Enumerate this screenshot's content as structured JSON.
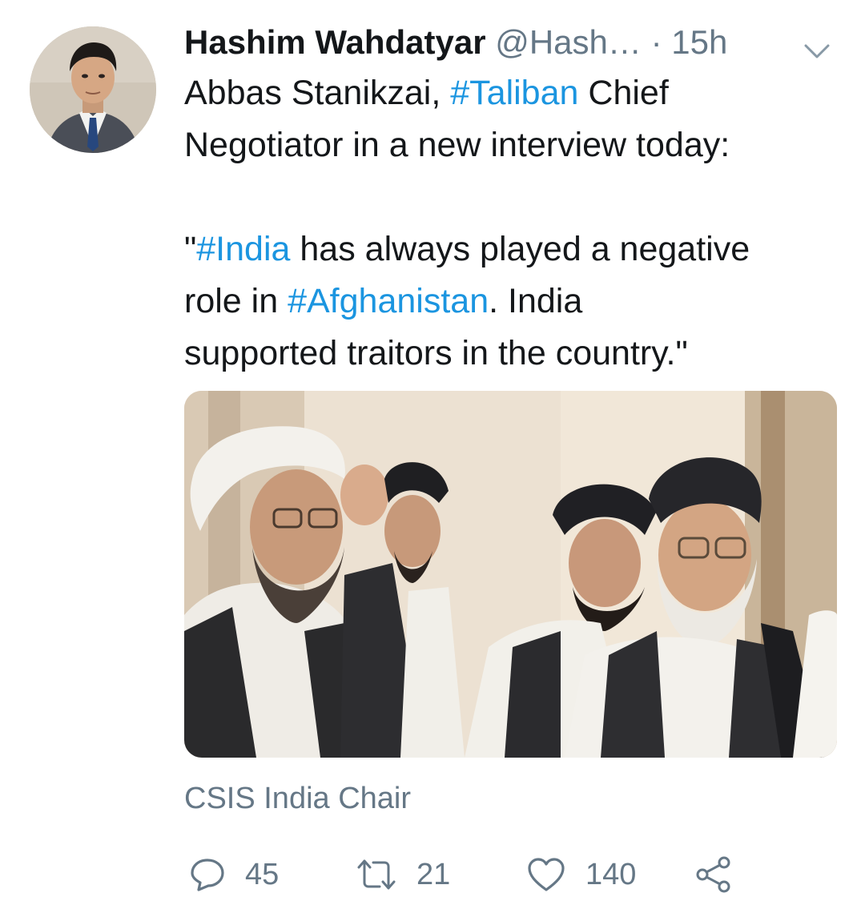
{
  "tweet": {
    "author_name": "Hashim Wahdatyar",
    "author_handle": "@Hash…",
    "separator": "·",
    "time": "15h",
    "text_line1_pre": "Abbas Stanikzai, ",
    "text_line1_tag": "#Taliban",
    "text_line1_post": " Chief",
    "text_line2": "Negotiator in a new interview today:",
    "quote_line1_pre": "\"",
    "quote_line1_tag": "#India",
    "quote_line1_post": " has always played a negative",
    "quote_line2_pre": "role in ",
    "quote_line2_tag": "#Afghanistan",
    "quote_line2_post": ".  India",
    "quote_line3": "supported traitors in the country.\"",
    "card_source": "CSIS India Chair"
  },
  "actions": {
    "reply_count": "45",
    "retweet_count": "21",
    "like_count": "140"
  },
  "icons": {
    "avatar": "profile-photo",
    "caret": "chevron-down-icon",
    "reply": "speech-bubble-icon",
    "retweet": "retweet-arrows-icon",
    "like": "heart-icon",
    "share": "share-nodes-icon"
  },
  "colors": {
    "hashtag": "#1b95e0",
    "secondary_text": "#657786",
    "primary_text": "#14171a"
  }
}
